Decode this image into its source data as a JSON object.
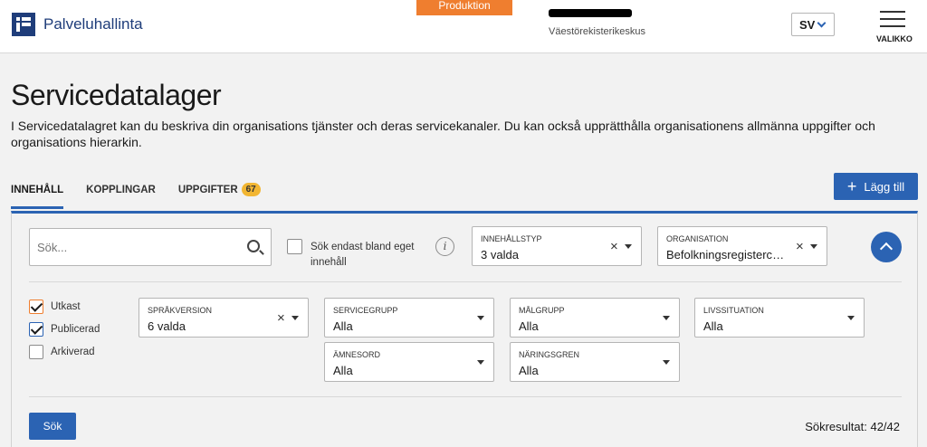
{
  "header": {
    "app_name": "Palveluhallinta",
    "environment": "Produktion",
    "organization": "Väestörekisterikeskus",
    "language": "SV",
    "menu_label": "VALIKKO"
  },
  "page": {
    "title": "Servicedatalager",
    "description": "I Servicedatalagret kan du beskriva din organisations tjänster och deras servicekanaler. Du kan också upprätthålla organisationens allmänna uppgifter och organisations hierarkin."
  },
  "tabs": [
    {
      "label": "INNEHÅLL",
      "active": true
    },
    {
      "label": "KOPPLINGAR",
      "active": false
    },
    {
      "label": "UPPGIFTER",
      "active": false,
      "badge": "67"
    }
  ],
  "add_button": {
    "label": "Lägg till"
  },
  "filters": {
    "search_placeholder": "Sök...",
    "own_content_label": "Sök endast bland eget innehåll",
    "content_type": {
      "label": "INNEHÅLLSTYP",
      "value": "3 valda"
    },
    "organization": {
      "label": "ORGANISATION",
      "value": "Befolkningsregistercentralen"
    },
    "language_version": {
      "label": "SPRÅKVERSION",
      "value": "6 valda"
    },
    "service_class": {
      "label": "SERVICEGRUPP",
      "value": "Alla"
    },
    "target_group": {
      "label": "MÅLGRUPP",
      "value": "Alla"
    },
    "life_event": {
      "label": "LIVSSITUATION",
      "value": "Alla"
    },
    "ontology": {
      "label": "ÄMNESORD",
      "value": "Alla"
    },
    "industry": {
      "label": "NÄRINGSGREN",
      "value": "Alla"
    },
    "statuses": [
      {
        "label": "Utkast",
        "checked": true
      },
      {
        "label": "Publicerad",
        "checked": true
      },
      {
        "label": "Arkiverad",
        "checked": false
      }
    ]
  },
  "search_button": {
    "label": "Sök"
  },
  "results": {
    "text": "Sökresultat: 42/42"
  }
}
